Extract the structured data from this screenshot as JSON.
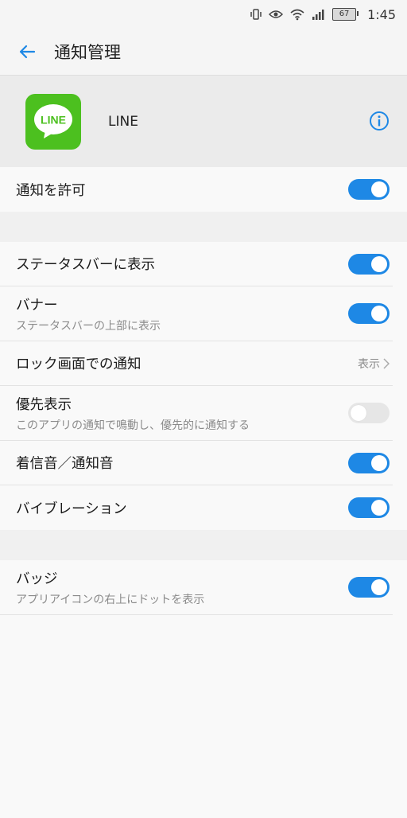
{
  "status_bar": {
    "battery": "67",
    "time": "1:45",
    "icons": [
      "vibrate-icon",
      "eye-icon",
      "wifi-icon",
      "signal-icon",
      "battery-icon"
    ]
  },
  "app_bar": {
    "title": "通知管理",
    "back_icon": "back-arrow-icon"
  },
  "app_header": {
    "app_name": "LINE",
    "logo_text": "LINE",
    "info_icon": "info-icon",
    "accent": "#1e88e5",
    "logo_color": "#4cc01f"
  },
  "allow": {
    "label": "通知を許可",
    "enabled": true
  },
  "settings": {
    "status_bar_display": {
      "label": "ステータスバーに表示",
      "enabled": true
    },
    "banner": {
      "label": "バナー",
      "sub": "ステータスバーの上部に表示",
      "enabled": true
    },
    "lock_screen": {
      "label": "ロック画面での通知",
      "value": "表示"
    },
    "priority": {
      "label": "優先表示",
      "sub": "このアプリの通知で鳴動し、優先的に通知する",
      "enabled": false
    },
    "ringtone": {
      "label": "着信音／通知音",
      "enabled": true
    },
    "vibration": {
      "label": "バイブレーション",
      "enabled": true
    }
  },
  "badge": {
    "label": "バッジ",
    "sub": "アプリアイコンの右上にドットを表示",
    "enabled": true
  }
}
